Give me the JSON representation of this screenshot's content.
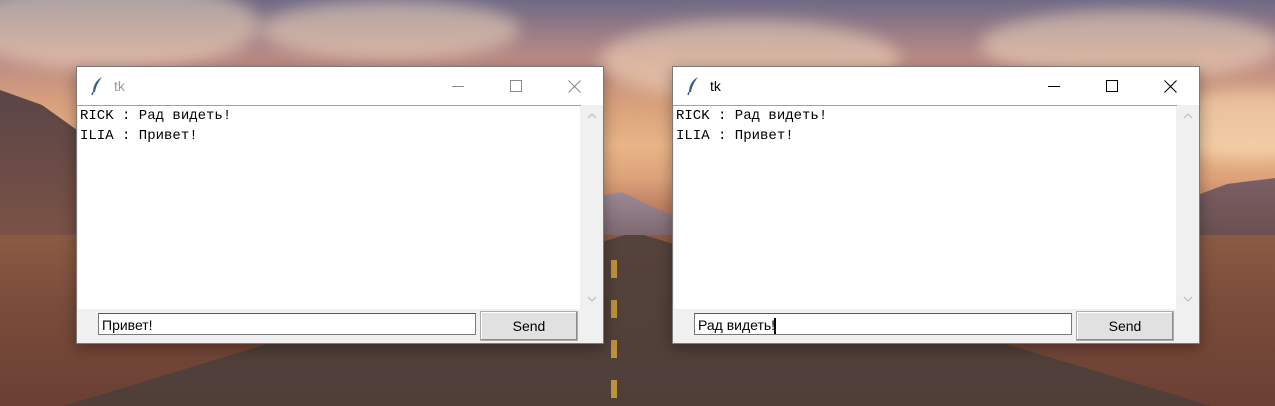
{
  "windows": [
    {
      "title": "tk",
      "state": "inactive",
      "minimize_glyph": "—",
      "maximize_glyph": "☐",
      "close_glyph": "✕",
      "messages": [
        "RICK : Рад видеть!",
        "ILIA : Привет!"
      ],
      "entry_value": "Привет!",
      "send_label": "Send"
    },
    {
      "title": "tk",
      "state": "active",
      "minimize_glyph": "—",
      "maximize_glyph": "☐",
      "close_glyph": "✕",
      "messages": [
        "RICK : Рад видеть!",
        "ILIA : Привет!"
      ],
      "entry_value": "Рад видеть!",
      "send_label": "Send"
    }
  ],
  "icons": {
    "app": "feather-icon",
    "scroll_up": "chevron-up-icon",
    "scroll_down": "chevron-down-icon"
  },
  "colors": {
    "window_bg": "#f0f0f0",
    "title_active": "#000000",
    "title_inactive": "#9a9a9a",
    "feather": "#3b5e8c"
  }
}
